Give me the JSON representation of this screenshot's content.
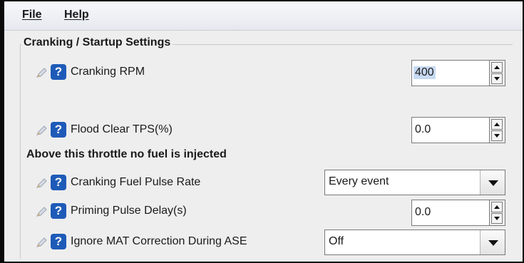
{
  "menu": {
    "file": "File",
    "help": "Help"
  },
  "section": {
    "title": "Cranking / Startup Settings"
  },
  "note": "Above this throttle no fuel is injected",
  "help_glyph": "?",
  "icons": {
    "edit": "pencil-icon",
    "help": "question-mark-icon",
    "spin_up": "triangle-up-icon",
    "spin_down": "triangle-down-icon",
    "dropdown": "triangle-down-icon"
  },
  "colors": {
    "help_badge": "#1e5bb8",
    "selection": "#c7daf3"
  },
  "settings": [
    {
      "label": "Cranking RPM",
      "type": "spinner",
      "value": "400"
    },
    {
      "label": "Flood Clear TPS(%)",
      "type": "spinner",
      "value": "0.0"
    },
    {
      "label": "Cranking Fuel Pulse Rate",
      "type": "combo",
      "value": "Every event"
    },
    {
      "label": "Priming Pulse Delay(s)",
      "type": "spinner",
      "value": "0.0"
    },
    {
      "label": "Ignore MAT Correction During ASE",
      "type": "combo",
      "value": "Off"
    }
  ]
}
